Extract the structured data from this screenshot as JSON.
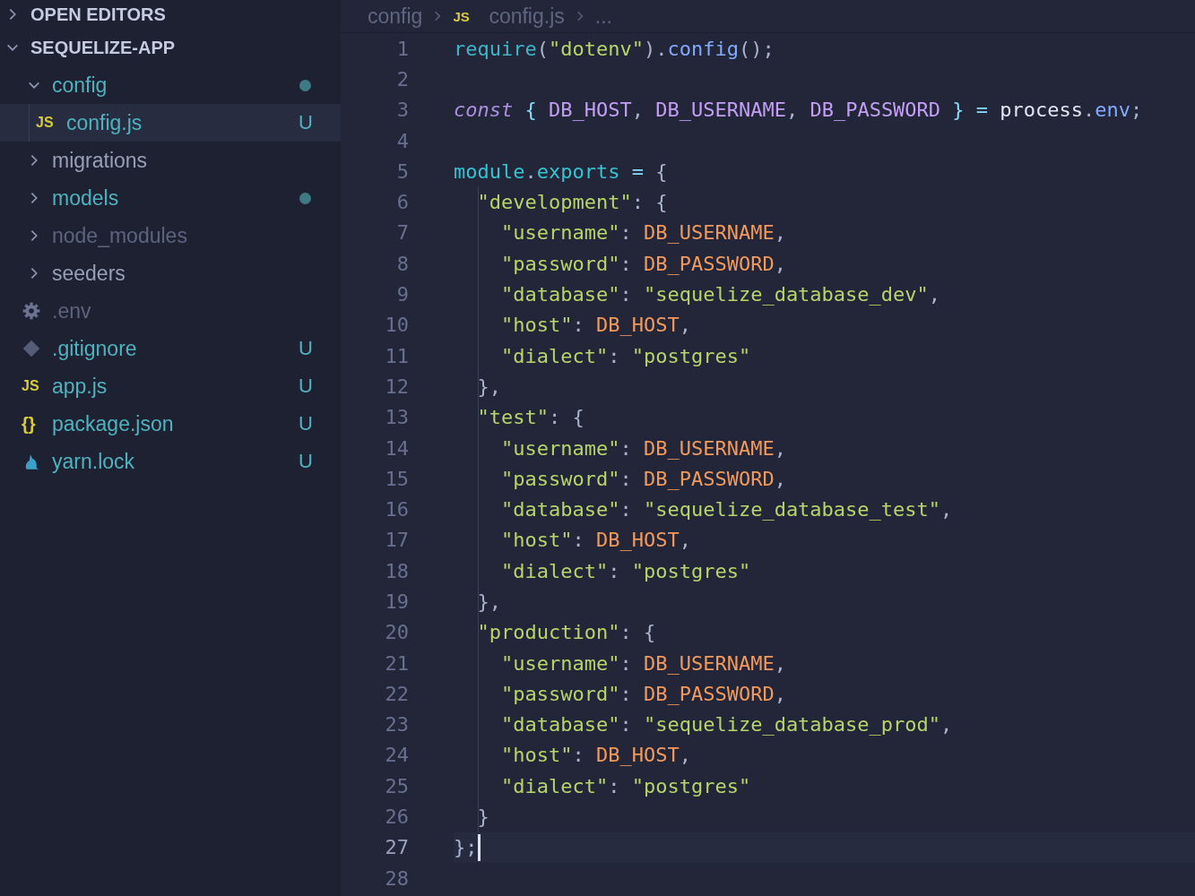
{
  "sidebar": {
    "sections": [
      {
        "title": "OPEN EDITORS",
        "expanded": false
      },
      {
        "title": "SEQUELIZE-APP",
        "expanded": true
      }
    ],
    "items": [
      {
        "label": "config",
        "kind": "folder",
        "expanded": true,
        "selected": false,
        "changed": true,
        "ignored": false,
        "children": [
          {
            "label": "config.js",
            "kind": "js",
            "icon_text": "JS",
            "selected": true,
            "changed": true,
            "ignored": false,
            "badge": "U"
          }
        ]
      },
      {
        "label": "migrations",
        "kind": "folder",
        "expanded": false,
        "selected": false,
        "changed": false,
        "ignored": false
      },
      {
        "label": "models",
        "kind": "folder",
        "expanded": false,
        "selected": false,
        "changed": true,
        "ignored": false
      },
      {
        "label": "node_modules",
        "kind": "folder",
        "expanded": false,
        "selected": false,
        "changed": false,
        "ignored": true
      },
      {
        "label": "seeders",
        "kind": "folder",
        "expanded": false,
        "selected": false,
        "changed": false,
        "ignored": false
      },
      {
        "label": ".env",
        "kind": "env",
        "selected": false,
        "changed": false,
        "ignored": true
      },
      {
        "label": ".gitignore",
        "kind": "git",
        "selected": false,
        "changed": true,
        "ignored": false,
        "badge": "U"
      },
      {
        "label": "app.js",
        "kind": "js",
        "icon_text": "JS",
        "selected": false,
        "changed": true,
        "ignored": false,
        "badge": "U"
      },
      {
        "label": "package.json",
        "kind": "json",
        "icon_text": "{}",
        "selected": false,
        "changed": true,
        "ignored": false,
        "badge": "U"
      },
      {
        "label": "yarn.lock",
        "kind": "yarn",
        "selected": false,
        "changed": true,
        "ignored": false,
        "badge": "U"
      }
    ]
  },
  "breadcrumbs": [
    {
      "label": "config"
    },
    {
      "label": "config.js",
      "icon_text": "JS"
    },
    {
      "label": "..."
    }
  ],
  "editor": {
    "lines": [
      {
        "number": "1",
        "current": false,
        "tokens": [
          {
            "kind": "fn",
            "text": "require"
          },
          {
            "kind": "p",
            "text": "("
          },
          {
            "kind": "str",
            "text": "\"dotenv\""
          },
          {
            "kind": "p",
            "text": ")."
          },
          {
            "kind": "prop",
            "text": "config"
          },
          {
            "kind": "p",
            "text": "();"
          }
        ]
      },
      {
        "number": "2",
        "current": false
      },
      {
        "number": "3",
        "current": false,
        "tokens": [
          {
            "kind": "kw",
            "text": "const"
          },
          {
            "kind": "op",
            "text": " { "
          },
          {
            "kind": "var",
            "text": "DB_HOST"
          },
          {
            "kind": "p",
            "text": ", "
          },
          {
            "kind": "var",
            "text": "DB_USERNAME"
          },
          {
            "kind": "p",
            "text": ", "
          },
          {
            "kind": "var",
            "text": "DB_PASSWORD"
          },
          {
            "kind": "op",
            "text": " } = "
          },
          {
            "kind": "id",
            "text": "process"
          },
          {
            "kind": "p",
            "text": "."
          },
          {
            "kind": "prop",
            "text": "env"
          },
          {
            "kind": "p",
            "text": ";"
          }
        ]
      },
      {
        "number": "4",
        "current": false
      },
      {
        "number": "5",
        "current": false,
        "tokens": [
          {
            "kind": "mod",
            "text": "module"
          },
          {
            "kind": "p",
            "text": "."
          },
          {
            "kind": "mod",
            "text": "exports"
          },
          {
            "kind": "op",
            "text": " = "
          },
          {
            "kind": "p",
            "text": "{"
          }
        ]
      },
      {
        "number": "6",
        "current": false,
        "tokens": [
          {
            "kind": "str",
            "text": "  \"development\""
          },
          {
            "kind": "p",
            "text": ": {"
          }
        ]
      },
      {
        "number": "7",
        "current": false,
        "tokens": [
          {
            "kind": "str",
            "text": "    \"username\""
          },
          {
            "kind": "p",
            "text": ": "
          },
          {
            "kind": "val",
            "text": "DB_USERNAME"
          },
          {
            "kind": "p",
            "text": ","
          }
        ]
      },
      {
        "number": "8",
        "current": false,
        "tokens": [
          {
            "kind": "str",
            "text": "    \"password\""
          },
          {
            "kind": "p",
            "text": ": "
          },
          {
            "kind": "val",
            "text": "DB_PASSWORD"
          },
          {
            "kind": "p",
            "text": ","
          }
        ]
      },
      {
        "number": "9",
        "current": false,
        "tokens": [
          {
            "kind": "str",
            "text": "    \"database\""
          },
          {
            "kind": "p",
            "text": ": "
          },
          {
            "kind": "str",
            "text": "\"sequelize_database_dev\""
          },
          {
            "kind": "p",
            "text": ","
          }
        ]
      },
      {
        "number": "10",
        "current": false,
        "tokens": [
          {
            "kind": "str",
            "text": "    \"host\""
          },
          {
            "kind": "p",
            "text": ": "
          },
          {
            "kind": "val",
            "text": "DB_HOST"
          },
          {
            "kind": "p",
            "text": ","
          }
        ]
      },
      {
        "number": "11",
        "current": false,
        "tokens": [
          {
            "kind": "str",
            "text": "    \"dialect\""
          },
          {
            "kind": "p",
            "text": ": "
          },
          {
            "kind": "str",
            "text": "\"postgres\""
          }
        ]
      },
      {
        "number": "12",
        "current": false,
        "tokens": [
          {
            "kind": "p",
            "text": "  },"
          }
        ]
      },
      {
        "number": "13",
        "current": false,
        "tokens": [
          {
            "kind": "str",
            "text": "  \"test\""
          },
          {
            "kind": "p",
            "text": ": {"
          }
        ]
      },
      {
        "number": "14",
        "current": false,
        "tokens": [
          {
            "kind": "str",
            "text": "    \"username\""
          },
          {
            "kind": "p",
            "text": ": "
          },
          {
            "kind": "val",
            "text": "DB_USERNAME"
          },
          {
            "kind": "p",
            "text": ","
          }
        ]
      },
      {
        "number": "15",
        "current": false,
        "tokens": [
          {
            "kind": "str",
            "text": "    \"password\""
          },
          {
            "kind": "p",
            "text": ": "
          },
          {
            "kind": "val",
            "text": "DB_PASSWORD"
          },
          {
            "kind": "p",
            "text": ","
          }
        ]
      },
      {
        "number": "16",
        "current": false,
        "tokens": [
          {
            "kind": "str",
            "text": "    \"database\""
          },
          {
            "kind": "p",
            "text": ": "
          },
          {
            "kind": "str",
            "text": "\"sequelize_database_test\""
          },
          {
            "kind": "p",
            "text": ","
          }
        ]
      },
      {
        "number": "17",
        "current": false,
        "tokens": [
          {
            "kind": "str",
            "text": "    \"host\""
          },
          {
            "kind": "p",
            "text": ": "
          },
          {
            "kind": "val",
            "text": "DB_HOST"
          },
          {
            "kind": "p",
            "text": ","
          }
        ]
      },
      {
        "number": "18",
        "current": false,
        "tokens": [
          {
            "kind": "str",
            "text": "    \"dialect\""
          },
          {
            "kind": "p",
            "text": ": "
          },
          {
            "kind": "str",
            "text": "\"postgres\""
          }
        ]
      },
      {
        "number": "19",
        "current": false,
        "tokens": [
          {
            "kind": "p",
            "text": "  },"
          }
        ]
      },
      {
        "number": "20",
        "current": false,
        "tokens": [
          {
            "kind": "str",
            "text": "  \"production\""
          },
          {
            "kind": "p",
            "text": ": {"
          }
        ]
      },
      {
        "number": "21",
        "current": false,
        "tokens": [
          {
            "kind": "str",
            "text": "    \"username\""
          },
          {
            "kind": "p",
            "text": ": "
          },
          {
            "kind": "val",
            "text": "DB_USERNAME"
          },
          {
            "kind": "p",
            "text": ","
          }
        ]
      },
      {
        "number": "22",
        "current": false,
        "tokens": [
          {
            "kind": "str",
            "text": "    \"password\""
          },
          {
            "kind": "p",
            "text": ": "
          },
          {
            "kind": "val",
            "text": "DB_PASSWORD"
          },
          {
            "kind": "p",
            "text": ","
          }
        ]
      },
      {
        "number": "23",
        "current": false,
        "tokens": [
          {
            "kind": "str",
            "text": "    \"database\""
          },
          {
            "kind": "p",
            "text": ": "
          },
          {
            "kind": "str",
            "text": "\"sequelize_database_prod\""
          },
          {
            "kind": "p",
            "text": ","
          }
        ]
      },
      {
        "number": "24",
        "current": false,
        "tokens": [
          {
            "kind": "str",
            "text": "    \"host\""
          },
          {
            "kind": "p",
            "text": ": "
          },
          {
            "kind": "val",
            "text": "DB_HOST"
          },
          {
            "kind": "p",
            "text": ","
          }
        ]
      },
      {
        "number": "25",
        "current": false,
        "tokens": [
          {
            "kind": "str",
            "text": "    \"dialect\""
          },
          {
            "kind": "p",
            "text": ": "
          },
          {
            "kind": "str",
            "text": "\"postgres\""
          }
        ]
      },
      {
        "number": "26",
        "current": false,
        "tokens": [
          {
            "kind": "p",
            "text": "  }"
          }
        ]
      },
      {
        "number": "27",
        "current": true,
        "tokens": [
          {
            "kind": "p",
            "text": "};"
          }
        ]
      },
      {
        "number": "28",
        "current": false
      }
    ]
  }
}
